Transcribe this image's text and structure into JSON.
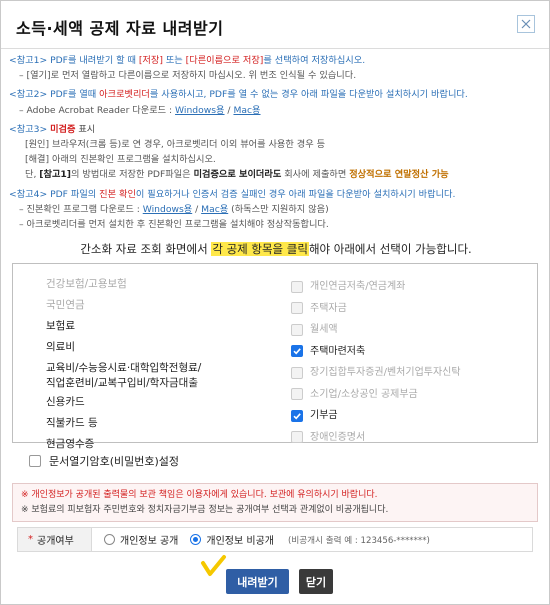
{
  "title": "소득·세액 공제 자료 내려받기",
  "notes": {
    "n1_head_a": "<참고1> PDF를 내려받기 할 때 ",
    "n1_head_b": "[저장]",
    "n1_head_c": " 또는 ",
    "n1_head_d": "[다른이름으로 저장]",
    "n1_head_e": "를 선택하여 저장하십시오.",
    "n1_sub": "– [열기]로 먼저 열람하고 다른이름으로 저장하지 마십시오. 위 번조 인식될 수 있습니다.",
    "n2_head_a": "<참고2> PDF를 열때 ",
    "n2_head_b": "아크로벳리더",
    "n2_head_c": "를 사용하시고, PDF를 열 수 없는 경우 아래 파일을 다운받아 설치하시기 바랍니다.",
    "n2_sub_a": "– Adobe Acrobat Reader 다운로드 : ",
    "n2_sub_win": "Windows용",
    "n2_sub_sep": " / ",
    "n2_sub_mac": "Mac용",
    "n3_head_a": "<참고3> ",
    "n3_head_b": "미검증",
    "n3_head_c": " 표시",
    "n3_sub1": "[원인] 브라우저(크롬 등)로 연 경우, 아크로벳리더 이외 뷰어를 사용한 경우 등",
    "n3_sub2": "[해결] 아래의 진본확인 프로그램을 설치하십시오.",
    "n3_sub3_a": "단, ",
    "n3_sub3_b": "[참고1]",
    "n3_sub3_c": "의 방법대로 저장한 PDF파일은 ",
    "n3_sub3_d": "미검증으로 보이더라도",
    "n3_sub3_e": " 회사에 제출하면 ",
    "n3_sub3_f": "정상적으로 연말정산 가능",
    "n4_head_a": "<참고4> PDF 파일의 ",
    "n4_head_b": "진본 확인",
    "n4_head_c": "이 필요하거나 인증서 검증 실패인 경우 아래 파일을 다운받아 설치하시기 바랍니다.",
    "n4_sub1_a": "– 진본확인 프로그램 다운로드 : ",
    "n4_sub1_win": "Windows용",
    "n4_sub1_sep": " / ",
    "n4_sub1_mac": "Mac용",
    "n4_sub1_b": " (하독스만 지원하지 않음)",
    "n4_sub2": "– 아크로벳리더를 먼저 설치한 후 진본확인 프로그램을 설치해야 정상작동합니다."
  },
  "info": {
    "before": "간소화 자료 조회 화면에서 ",
    "highlight": "각 공제 항목을 클릭",
    "after": "해야 아래에서 선택이 가능합니다."
  },
  "left_items": [
    {
      "label": "건강보험/고용보험"
    },
    {
      "label": "국민연금"
    },
    {
      "label": "보험료"
    },
    {
      "label": "의료비"
    },
    {
      "label": "교육비/수능응시료·대학입학전형료/",
      "label2": "직업훈련비/교복구입비/학자금대출"
    },
    {
      "label": "신용카드"
    },
    {
      "label": "직불카드 등"
    },
    {
      "label": "현금영수증"
    }
  ],
  "right_items": [
    {
      "label": "개인연금저축/연금계좌"
    },
    {
      "label": "주택자금"
    },
    {
      "label": "월세액"
    },
    {
      "label": "주택마련저축"
    },
    {
      "label": "장기집합투자증권/벤처기업투자신탁"
    },
    {
      "label": "소기업/소상공인 공제부금"
    },
    {
      "label": "기부금"
    },
    {
      "label": "장애인증명서"
    }
  ],
  "password_option": "문서열기암호(비밀번호)설정",
  "warnings": {
    "line1": "※ 개인정보가 공개된 출력물의 보관 책임은 이용자에게 있습니다. 보관에 유의하시기 바랍니다.",
    "line2": "※ 보험료의 피보험자 주민번호와 정치자금기부금 정보는 공개여부 선택과 관계없이 비공개됩니다."
  },
  "publicity": {
    "star": "*",
    "label": "공개여부",
    "option_public": "개인정보 공개",
    "option_private": "개인정보 비공개",
    "note": "(비공개시 출력 예 : 123456-*******)",
    "selected": "개인정보 비공개"
  },
  "buttons": {
    "download": "내려받기",
    "close": "닫기"
  },
  "colors": {
    "accent": "#2f5ea5",
    "note_blue": "#2b6fb6",
    "warning_red": "#d32020",
    "highlight": "#ffe84a",
    "check_blue": "#1a73e8"
  },
  "icons": [
    "close-icon",
    "checkmark-icon"
  ]
}
